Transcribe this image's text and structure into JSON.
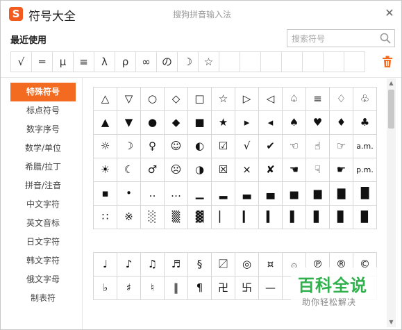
{
  "window": {
    "logo_letter": "S",
    "title": "符号大全",
    "subtitle": "搜狗拼音输入法",
    "close_label": "✕"
  },
  "recent": {
    "label": "最近使用",
    "symbols": [
      "√",
      "═",
      "μ",
      "≡",
      "λ",
      "ρ",
      "∞",
      "の",
      "☽",
      "☆",
      "",
      "",
      "",
      "",
      "",
      "",
      ""
    ]
  },
  "search": {
    "placeholder": "搜索符号"
  },
  "sidebar": {
    "items": [
      {
        "label": "特殊符号",
        "active": true
      },
      {
        "label": "标点符号"
      },
      {
        "label": "数字序号"
      },
      {
        "label": "数学/单位"
      },
      {
        "label": "希腊/拉丁"
      },
      {
        "label": "拼音/注音"
      },
      {
        "label": "中文字符"
      },
      {
        "label": "英文音标"
      },
      {
        "label": "日文字符"
      },
      {
        "label": "韩文字符"
      },
      {
        "label": "俄文字母"
      },
      {
        "label": "制表符"
      }
    ]
  },
  "grid_special": [
    [
      "△",
      "▽",
      "○",
      "◇",
      "□",
      "☆",
      "▷",
      "◁",
      "♤",
      "≡",
      "♢",
      "♧"
    ],
    [
      "▲",
      "▼",
      "●",
      "◆",
      "■",
      "★",
      "▸",
      "◂",
      "♠",
      "♥",
      "♦",
      "♣"
    ],
    [
      "☼",
      "☽",
      "♀",
      "☺",
      "◐",
      "☑",
      "√",
      "✔",
      "☜",
      "☝",
      "☞",
      "a.m."
    ],
    [
      "☀",
      "☾",
      "♂",
      "☹",
      "◑",
      "☒",
      "×",
      "✘",
      "☚",
      "☟",
      "☛",
      "p.m."
    ],
    [
      "▪",
      "•",
      "‥",
      "…",
      "▁",
      "▂",
      "▃",
      "▄",
      "▅",
      "▆",
      "▇",
      "█"
    ],
    [
      "∷",
      "※",
      "░",
      "▒",
      "▓",
      "▏",
      "▎",
      "▍",
      "▌",
      "▋",
      "▊",
      "▉"
    ]
  ],
  "grid_second": [
    [
      "♩",
      "♪",
      "♫",
      "♬",
      "§",
      "〼",
      "◎",
      "¤",
      "۞",
      "℗",
      "®",
      "©"
    ],
    [
      "♭",
      "♯",
      "♮",
      "‖",
      "¶",
      "卍",
      "卐",
      "—",
      "",
      "",
      "",
      ""
    ]
  ],
  "watermark": {
    "title": "百科全说",
    "subtitle": "助你轻松解决"
  },
  "colors": {
    "accent": "#f26b20",
    "logo": "#f25a1f",
    "watermark": "#2fb04d"
  }
}
